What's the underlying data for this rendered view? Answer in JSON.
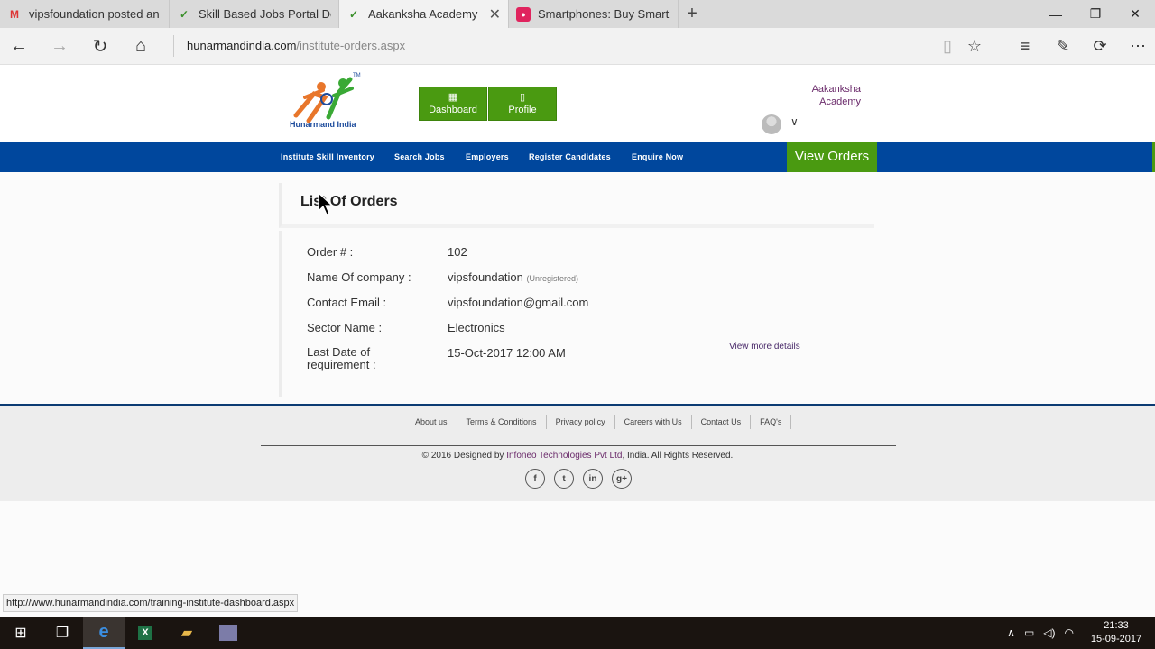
{
  "browser": {
    "tabs": [
      {
        "title": "vipsfoundation posted an o",
        "icon": "gmail-icon",
        "active": false
      },
      {
        "title": "Skill Based Jobs Portal Delhi",
        "icon": "site-icon",
        "active": false
      },
      {
        "title": "Aakanksha Academy",
        "icon": "site-icon",
        "active": true,
        "close": "✕"
      },
      {
        "title": "Smartphones: Buy Smartph",
        "icon": "shop-icon",
        "active": false
      }
    ],
    "new_tab": "+",
    "url_host": "hunarmandindia.com",
    "url_path": "/institute-orders.aspx",
    "status_url": "http://www.hunarmandindia.com/training-institute-dashboard.aspx"
  },
  "header": {
    "logo_text": "Hunarmand India",
    "logo_tm": "TM",
    "dashboard_label": "Dashboard",
    "profile_label": "Profile",
    "user_name_line1": "Aakanksha",
    "user_name_line2": "Academy"
  },
  "nav": {
    "items": [
      "Institute Skill Inventory",
      "Search Jobs",
      "Employers",
      "Register Candidates",
      "Enquire Now"
    ],
    "view_orders": "View Orders"
  },
  "orders": {
    "title": "List Of Orders",
    "fields": [
      {
        "label": "Order # :",
        "value": "102"
      },
      {
        "label": "Name Of company :",
        "value": "vipsfoundation",
        "note": "(Unregistered)"
      },
      {
        "label": "Contact Email :",
        "value": "vipsfoundation@gmail.com"
      },
      {
        "label": "Sector Name :",
        "value": "Electronics"
      },
      {
        "label_line1": "Last Date of",
        "label_line2": "requirement :",
        "value": "15-Oct-2017 12:00 AM"
      }
    ],
    "view_more": "View more details"
  },
  "footer": {
    "links": [
      "About us",
      "Terms & Conditions",
      "Privacy policy",
      "Careers with Us",
      "Contact Us",
      "FAQ's"
    ],
    "copyright_pre": "© 2016 Designed by ",
    "copyright_brand": "Infoneo Technologies Pvt Ltd",
    "copyright_post": ", India. All Rights Reserved.",
    "social": [
      "f",
      "t",
      "in",
      "g+"
    ]
  },
  "taskbar": {
    "time": "21:33",
    "date": "15-09-2017"
  },
  "colors": {
    "nav_blue": "#00479d",
    "brand_green": "#4a9a11",
    "accent_purple": "#6b2b6b"
  }
}
